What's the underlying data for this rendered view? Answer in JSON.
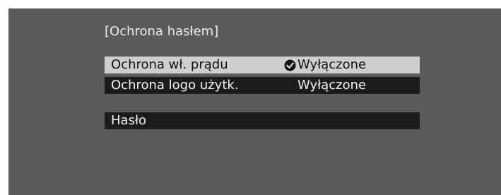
{
  "menu": {
    "title": "[Ochrona hasłem]",
    "items": [
      {
        "label": "Ochrona wł. prądu",
        "value": "Wyłączone",
        "selected": true,
        "icon": "check-circle-icon"
      },
      {
        "label": "Ochrona logo użytk.",
        "value": "Wyłączone",
        "selected": false
      },
      {
        "label": "Hasło",
        "value": "",
        "selected": false
      }
    ]
  },
  "colors": {
    "screen_background": "#5b5b5b",
    "row_background": "#1c1c1c",
    "row_selected_background": "#cfcfcf"
  }
}
